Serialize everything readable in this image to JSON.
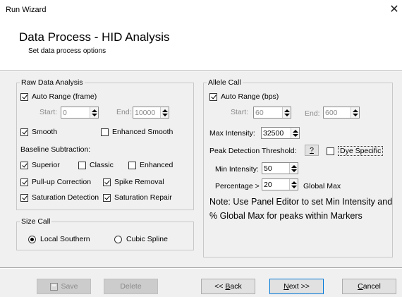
{
  "window": {
    "title": "Run Wizard",
    "close_glyph": "✕"
  },
  "header": {
    "title": "Data Process - HID Analysis",
    "subtitle": "Set data process options"
  },
  "raw_data_analysis": {
    "legend": "Raw Data Analysis",
    "auto_range": {
      "label": "Auto Range (frame)",
      "checked": true
    },
    "start_label": "Start:",
    "start_value": "0",
    "end_label": "End:",
    "end_value": "10000",
    "smooth": {
      "label": "Smooth",
      "checked": true
    },
    "enhanced_smooth": {
      "label": "Enhanced Smooth",
      "checked": false
    },
    "baseline_label": "Baseline Subtraction:",
    "superior": {
      "label": "Superior",
      "checked": true
    },
    "classic": {
      "label": "Classic",
      "checked": false
    },
    "enhanced": {
      "label": "Enhanced",
      "checked": false
    },
    "pullup": {
      "label": "Pull-up Correction",
      "checked": true
    },
    "spike": {
      "label": "Spike Removal",
      "checked": true
    },
    "sat_detect": {
      "label": "Saturation Detection",
      "checked": true
    },
    "sat_repair": {
      "label": "Saturation Repair",
      "checked": true
    }
  },
  "size_call": {
    "legend": "Size Call",
    "local_southern": {
      "label": "Local Southern",
      "selected": true
    },
    "cubic_spline": {
      "label": "Cubic Spline",
      "selected": false
    }
  },
  "allele_call": {
    "legend": "Allele Call",
    "auto_range": {
      "label": "Auto Range (bps)",
      "checked": true
    },
    "start_label": "Start:",
    "start_value": "60",
    "end_label": "End:",
    "end_value": "600",
    "max_intensity_label": "Max Intensity:",
    "max_intensity_value": "32500",
    "peak_threshold_label": "Peak Detection Threshold:",
    "help_button": "?",
    "dye_specific": {
      "label": "Dye Specific",
      "checked": false
    },
    "min_intensity_label": "Min Intensity:",
    "min_intensity_value": "50",
    "percentage_label": "Percentage >",
    "percentage_value": "20",
    "global_max_label": "Global Max",
    "note": "Note: Use Panel Editor to set Min Intensity and % Global Max for peaks within Markers"
  },
  "footer": {
    "save": "Save",
    "delete": "Delete",
    "back_prefix": "<< ",
    "back_key": "B",
    "back_rest": "ack",
    "next_key": "N",
    "next_rest": "ext >>",
    "cancel_key": "C",
    "cancel_rest": "ancel"
  }
}
